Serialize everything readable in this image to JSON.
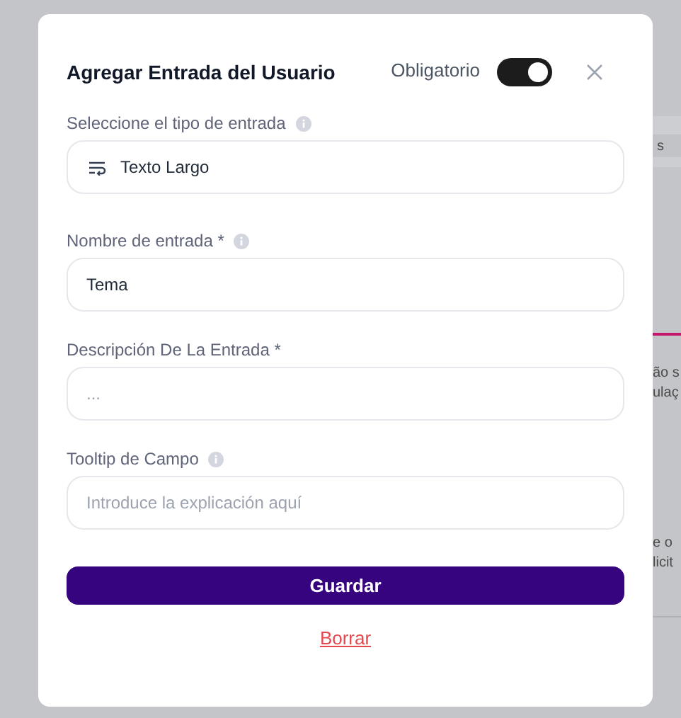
{
  "dialog": {
    "title": "Agregar Entrada del Usuario",
    "required_toggle": {
      "label": "Obligatorio",
      "on": true
    },
    "fields": [
      {
        "label": "Seleccione el tipo de entrada",
        "info": true,
        "kind": "select",
        "value": "Texto Largo"
      },
      {
        "label": "Nombre de entrada *",
        "info": true,
        "kind": "text",
        "value": "Tema"
      },
      {
        "label": "Descripción De La Entrada *",
        "info": false,
        "kind": "text",
        "placeholder": "..."
      },
      {
        "label": "Tooltip de Campo",
        "info": true,
        "kind": "text",
        "placeholder": "Introduce la explicación aquí"
      }
    ],
    "save_button": "Guardar",
    "delete_link": "Borrar"
  },
  "background": {
    "header": "s",
    "paragraphs": [
      [
        "ão s",
        "ulaç"
      ],
      [
        "e o",
        "licit"
      ]
    ]
  }
}
